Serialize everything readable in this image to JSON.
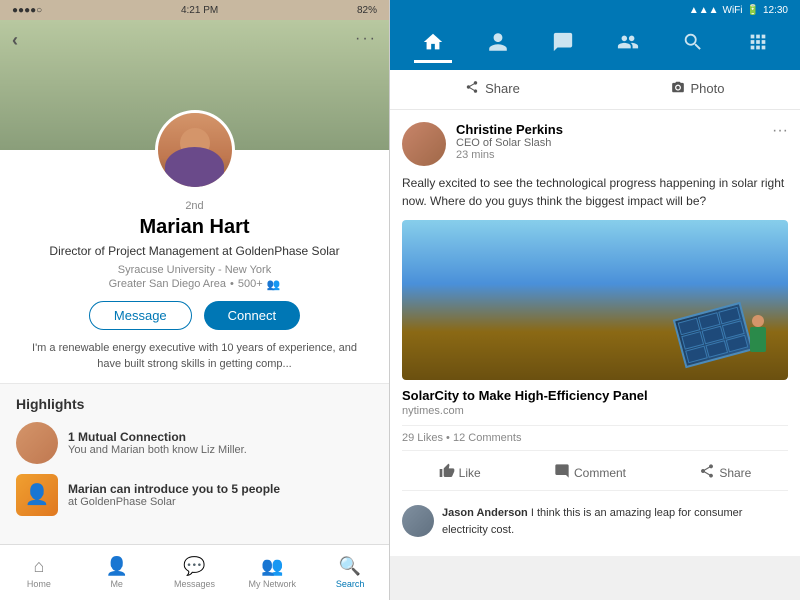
{
  "left_phone": {
    "status_bar": {
      "dots": "●●●●○",
      "wifi": "WiFi",
      "time": "4:21 PM",
      "battery": "82%"
    },
    "profile": {
      "connection_degree": "2nd",
      "name": "Marian Hart",
      "title": "Director of Project Management at GoldenPhase Solar",
      "school": "Syracuse University - New York",
      "location": "Greater San Diego Area",
      "connections": "500+",
      "message_btn": "Message",
      "connect_btn": "Connect",
      "summary": "I'm a renewable energy executive with 10 years of experience, and have built strong skills in getting comp..."
    },
    "highlights": {
      "title": "Highlights",
      "items": [
        {
          "type": "mutual",
          "main": "1 Mutual Connection",
          "sub": "You and Marian both know Liz Miller."
        },
        {
          "type": "intro",
          "main": "Marian can introduce you to 5 people",
          "sub": "at GoldenPhase Solar"
        }
      ]
    },
    "bottom_nav": [
      {
        "label": "Home",
        "icon": "⌂",
        "active": false
      },
      {
        "label": "Me",
        "icon": "👤",
        "active": false
      },
      {
        "label": "Messages",
        "icon": "💬",
        "active": false
      },
      {
        "label": "My Network",
        "icon": "👥",
        "active": false
      },
      {
        "label": "Search",
        "icon": "🔍",
        "active": true
      }
    ]
  },
  "right_phone": {
    "status_bar": {
      "time": "12:30",
      "icons": "signal wifi battery"
    },
    "top_nav": {
      "icons": [
        "home",
        "profile",
        "messaging",
        "network",
        "search",
        "grid"
      ]
    },
    "share_bar": {
      "share_label": "Share",
      "photo_label": "Photo"
    },
    "post": {
      "author": {
        "name": "Christine Perkins",
        "title": "CEO of Solar Slash",
        "time": "23 mins"
      },
      "text": "Really excited to see the technological progress happening in solar right now. Where do you guys think the biggest impact will be?",
      "link": {
        "title": "SolarCity to Make High-Efficiency Panel",
        "source": "nytimes.com"
      },
      "stats": {
        "likes": "29 Likes",
        "comments": "12 Comments"
      },
      "actions": [
        "Like",
        "Comment",
        "Share"
      ],
      "comment": {
        "author": "Jason Anderson",
        "text": "I think this is an amazing leap for consumer electricity cost."
      }
    }
  }
}
